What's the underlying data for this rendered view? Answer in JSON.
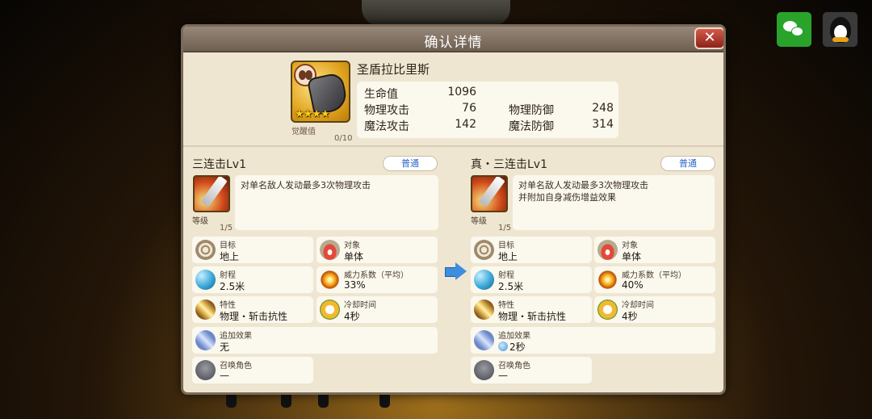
{
  "dialog": {
    "title": "确认详情",
    "close_label": "✕"
  },
  "share": {
    "wechat_icon": "wechat-icon",
    "qq_icon": "qq-icon"
  },
  "character": {
    "name": "圣盾拉比里斯",
    "stars": "★★★★",
    "awaken_label": "觉醒值",
    "awaken_value": "0/10",
    "stats": {
      "hp_label": "生命值",
      "hp": "1096",
      "patk_label": "物理攻击",
      "patk": "76",
      "pdef_label": "物理防御",
      "pdef": "248",
      "matk_label": "魔法攻击",
      "matk": "142",
      "mdef_label": "魔法防御",
      "mdef": "314"
    }
  },
  "left": {
    "name": "三连击Lv1",
    "type": "普通",
    "level_label": "等级",
    "level_value": "1/5",
    "desc": "对单名敌人发动最多3次物理攻击",
    "target_label": "目标",
    "target_value": "地上",
    "object_label": "对象",
    "object_value": "单体",
    "range_label": "射程",
    "range_value": "2.5米",
    "power_label": "威力系数（平均）",
    "power_value": "33%",
    "trait_label": "特性",
    "trait_value": "物理・斩击抗性",
    "cd_label": "冷却时间",
    "cd_value": "4秒",
    "extra_label": "追加效果",
    "extra_value": "无",
    "summon_label": "召唤角色",
    "summon_value": "—"
  },
  "right": {
    "name": "真・三连击Lv1",
    "type": "普通",
    "level_label": "等级",
    "level_value": "1/5",
    "desc_line1": "对单名敌人发动最多3次物理攻击",
    "desc_line2": "并附加自身减伤增益效果",
    "target_label": "目标",
    "target_value": "地上",
    "object_label": "对象",
    "object_value": "单体",
    "range_label": "射程",
    "range_value": "2.5米",
    "power_label": "威力系数（平均）",
    "power_value": "40%",
    "trait_label": "特性",
    "trait_value": "物理・斩击抗性",
    "cd_label": "冷却时间",
    "cd_value": "4秒",
    "extra_label": "追加效果",
    "extra_value": "2秒",
    "summon_label": "召唤角色",
    "summon_value": "—"
  },
  "colors": {
    "title_bar": "#7f7063",
    "panel": "#efe6d2",
    "pill_text": "#2a66c8",
    "close": "#b33a2c"
  }
}
